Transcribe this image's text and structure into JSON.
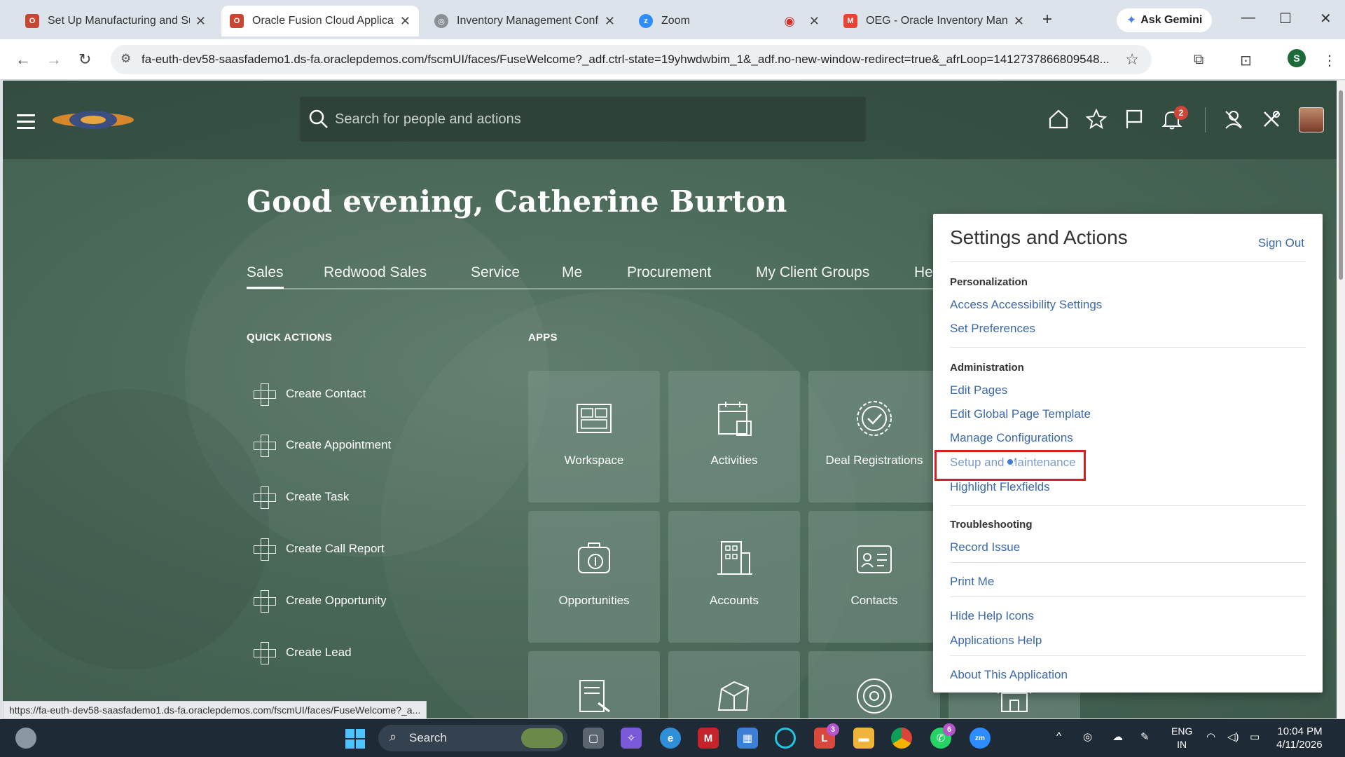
{
  "browser": {
    "tabs": [
      {
        "title": "Set Up Manufacturing and Sup",
        "favicon": "oracle-icon",
        "color": "#c74634"
      },
      {
        "title": "Oracle Fusion Cloud Applicatic",
        "favicon": "oracle-icon",
        "color": "#c74634"
      },
      {
        "title": "Inventory Management Config",
        "favicon": "globe-icon",
        "color": "#8a8f96"
      },
      {
        "title": "Zoom",
        "favicon": "zoom-icon",
        "color": "#2d8cff"
      },
      {
        "title": "OEG - Oracle Inventory Manag",
        "favicon": "gmail-icon",
        "color": "#ea4335"
      }
    ],
    "gemini_label": "Ask Gemini",
    "url": "fa-euth-dev58-saasfademo1.ds-fa.oraclepdemos.com/fscmUI/faces/FuseWelcome?_adf.ctrl-state=19yhwdwbim_1&_adf.no-new-window-redirect=true&_afrLoop=1412737866809548...",
    "profile_initial": "S",
    "status_url": "https://fa-euth-dev58-saasfademo1.ds-fa.oraclepdemos.com/fscmUI/faces/FuseWelcome?_a..."
  },
  "header": {
    "search_placeholder": "Search for people and actions",
    "notification_count": "2"
  },
  "greeting": "Good evening, Catherine Burton",
  "nav_tabs": [
    "Sales",
    "Redwood Sales",
    "Service",
    "Me",
    "Procurement",
    "My Client Groups",
    "He"
  ],
  "quick_actions": {
    "heading": "QUICK ACTIONS",
    "items": [
      "Create Contact",
      "Create Appointment",
      "Create Task",
      "Create Call Report",
      "Create Opportunity",
      "Create Lead"
    ]
  },
  "apps": {
    "heading": "APPS",
    "tiles": [
      {
        "label": "Workspace",
        "icon": "workspace-icon"
      },
      {
        "label": "Activities",
        "icon": "activities-icon"
      },
      {
        "label": "Deal Registrations",
        "icon": "deal-registrations-icon"
      },
      {
        "label": "Opportunities",
        "icon": "opportunities-icon"
      },
      {
        "label": "Accounts",
        "icon": "accounts-icon"
      },
      {
        "label": "Contacts",
        "icon": "contacts-icon"
      }
    ]
  },
  "settings_panel": {
    "title": "Settings and Actions",
    "sign_out": "Sign Out",
    "personalization": {
      "heading": "Personalization",
      "links": [
        "Access Accessibility Settings",
        "Set Preferences"
      ]
    },
    "administration": {
      "heading": "Administration",
      "links": [
        "Edit Pages",
        "Edit Global Page Template",
        "Manage Configurations",
        "Setup and Maintenance",
        "Highlight Flexfields"
      ]
    },
    "troubleshooting": {
      "heading": "Troubleshooting",
      "links": [
        "Record Issue"
      ]
    },
    "print_me": "Print Me",
    "help_links": [
      "Hide Help Icons",
      "Applications Help"
    ],
    "about": "About This Application"
  },
  "taskbar": {
    "search_label": "Search",
    "lang_line1": "ENG",
    "lang_line2": "IN",
    "time": "10:04 PM",
    "date": "4/11/2026",
    "badges": {
      "l_app": "3",
      "whatsapp": "6"
    }
  },
  "colors": {
    "link": "#3c6aa8",
    "highlight": "#d32023",
    "app_bg": "#4a6858"
  }
}
